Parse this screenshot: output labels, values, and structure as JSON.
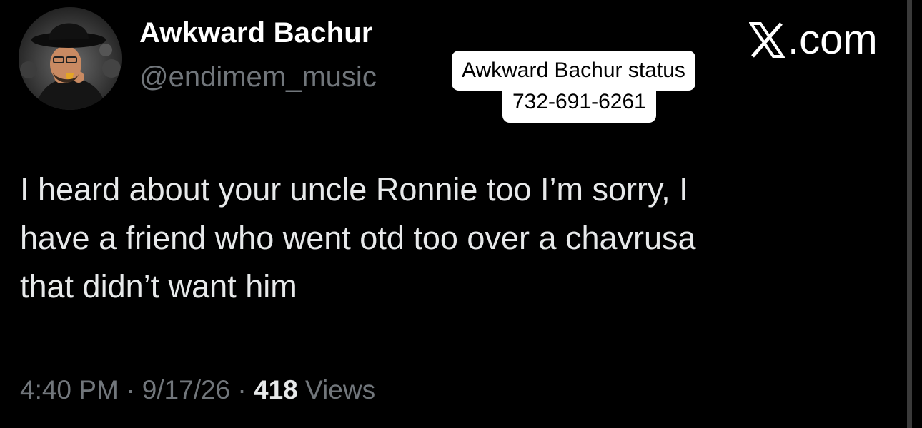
{
  "post": {
    "author": {
      "display_name": "Awkward Bachur",
      "handle": "@endimem_music",
      "avatar": "avatar-photo"
    },
    "brand": {
      "logo": "x-logo-icon",
      "suffix": ".com"
    },
    "sticker": {
      "line1": "Awkward Bachur status",
      "line2": "732-691-6261"
    },
    "text_lines": [
      "I heard about your uncle Ronnie too I’m sorry, I",
      "have a friend who went otd too over a chavrusa",
      "that didn’t want him"
    ],
    "meta": {
      "time": "4:40 PM",
      "sep1": "·",
      "date": "9/17/26",
      "sep2": "·",
      "views_count": "418",
      "views_label": "Views"
    }
  },
  "colors": {
    "background": "#000000",
    "primary_text": "#e7e9ea",
    "secondary_text": "#71767b",
    "sticker_bg": "#ffffff"
  }
}
